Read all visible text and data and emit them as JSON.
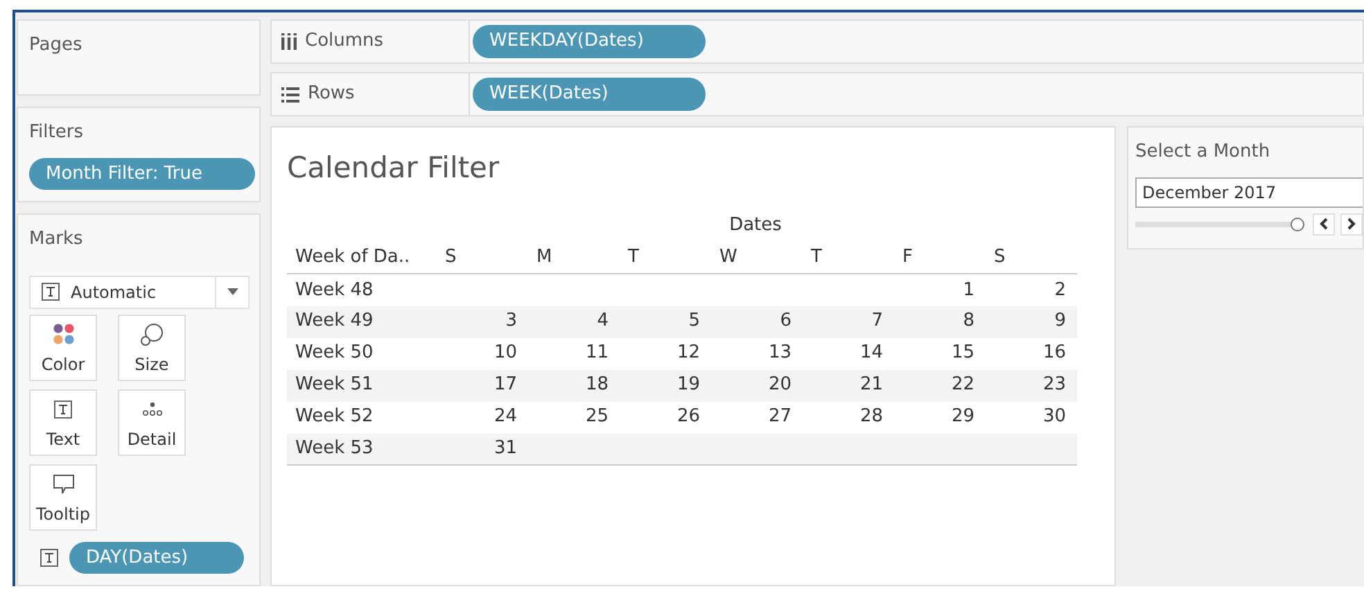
{
  "pages": {
    "title": "Pages"
  },
  "shelves": [
    {
      "kind": "columns",
      "label": "Columns",
      "pill": "WEEKDAY(Dates)"
    },
    {
      "kind": "rows",
      "label": "Rows",
      "pill": "WEEK(Dates)"
    }
  ],
  "filters": {
    "title": "Filters",
    "pills": [
      "Month Filter: True"
    ]
  },
  "marks": {
    "title": "Marks",
    "mark_type": "Automatic",
    "cards": [
      {
        "kind": "color",
        "label": "Color"
      },
      {
        "kind": "size",
        "label": "Size"
      },
      {
        "kind": "text",
        "label": "Text"
      },
      {
        "kind": "detail",
        "label": "Detail"
      },
      {
        "kind": "tooltip",
        "label": "Tooltip"
      }
    ],
    "fields": [
      {
        "kind": "text",
        "pill": "DAY(Dates)"
      }
    ]
  },
  "view": {
    "title": "Calendar Filter",
    "column_group": "Dates",
    "row_header": "Week of Da..",
    "columns": [
      "S",
      "M",
      "T",
      "W",
      "T",
      "F",
      "S"
    ],
    "rows": [
      {
        "label": "Week 48",
        "cells": [
          "",
          "",
          "",
          "",
          "",
          "1",
          "2"
        ]
      },
      {
        "label": "Week 49",
        "cells": [
          "3",
          "4",
          "5",
          "6",
          "7",
          "8",
          "9"
        ]
      },
      {
        "label": "Week 50",
        "cells": [
          "10",
          "11",
          "12",
          "13",
          "14",
          "15",
          "16"
        ]
      },
      {
        "label": "Week 51",
        "cells": [
          "17",
          "18",
          "19",
          "20",
          "21",
          "22",
          "23"
        ]
      },
      {
        "label": "Week 52",
        "cells": [
          "24",
          "25",
          "26",
          "27",
          "28",
          "29",
          "30"
        ]
      },
      {
        "label": "Week 53",
        "cells": [
          "31",
          "",
          "",
          "",
          "",
          "",
          ""
        ]
      }
    ]
  },
  "month_filter": {
    "title": "Select a Month",
    "value": "December 2017",
    "level": 1
  }
}
